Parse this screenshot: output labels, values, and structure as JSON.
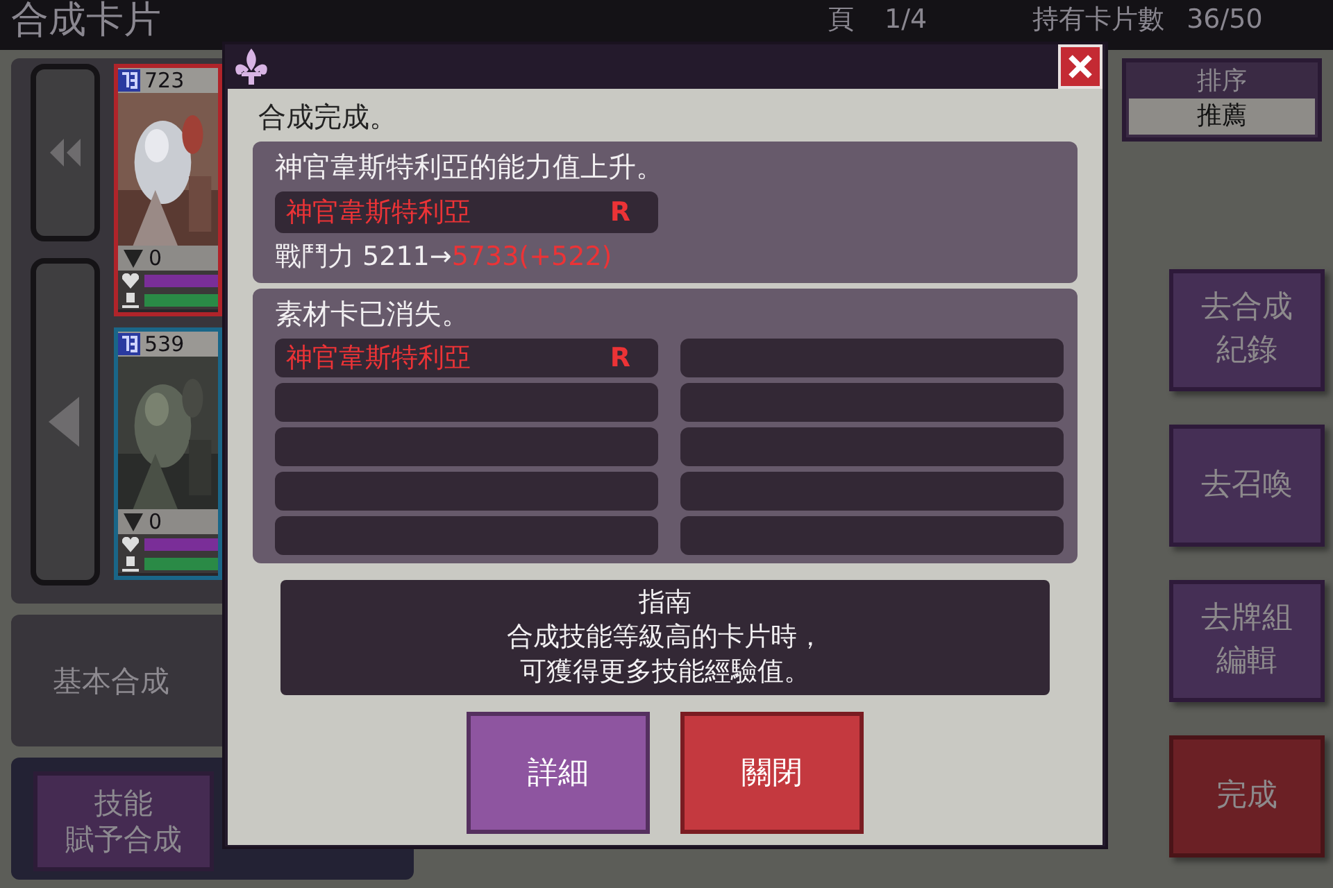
{
  "header": {
    "title": "合成卡片",
    "page_label": "頁",
    "page": "1/4",
    "owned_label": "持有卡片數",
    "owned": "36/50"
  },
  "sort": {
    "label": "排序",
    "value": "推薦"
  },
  "cards": [
    {
      "cost": "723",
      "color": "#b0242a",
      "count": "0",
      "bars": [
        {
          "level": 1
        },
        {
          "level": 1
        }
      ]
    },
    {
      "cost": "539",
      "color": "#1a6688",
      "count": "0",
      "bars": [
        {
          "level": 1
        },
        {
          "level": 1
        }
      ]
    }
  ],
  "modes": [
    {
      "lines": [
        "基本合成"
      ],
      "selected": false
    },
    {
      "lines": [
        "技能",
        "賦予合成"
      ],
      "selected": true
    }
  ],
  "side_buttons": [
    {
      "lines": [
        "去合成",
        "紀錄"
      ],
      "kind": "purple"
    },
    {
      "lines": [
        "去召喚"
      ],
      "kind": "purple"
    },
    {
      "lines": [
        "去牌組",
        "編輯"
      ],
      "kind": "purple"
    },
    {
      "lines": [
        "完成"
      ],
      "kind": "red"
    }
  ],
  "dialog": {
    "heading": "合成完成。",
    "result": {
      "message": "神官韋斯特利亞的能力值上升。",
      "card": {
        "name": "神官韋斯特利亞",
        "rarity": "R"
      },
      "stat_before": "戰鬥力 5211→",
      "stat_after": "5733(+522)"
    },
    "materials": {
      "message": "素材卡已消失。",
      "slots": [
        {
          "kind": "card",
          "name": "神官韋斯特利亞",
          "rarity": "R"
        },
        {
          "kind": "empty"
        },
        {
          "kind": "empty"
        },
        {
          "kind": "empty"
        },
        {
          "kind": "empty"
        },
        {
          "kind": "empty"
        },
        {
          "kind": "empty"
        },
        {
          "kind": "empty"
        },
        {
          "kind": "empty"
        },
        {
          "kind": "empty"
        }
      ]
    },
    "guide": {
      "title": "指南",
      "lines": [
        "合成技能等級高的卡片時，",
        "可獲得更多技能經驗值。"
      ]
    },
    "buttons": [
      {
        "label": "詳細",
        "kind": "purple"
      },
      {
        "label": "關閉",
        "kind": "red"
      }
    ]
  }
}
